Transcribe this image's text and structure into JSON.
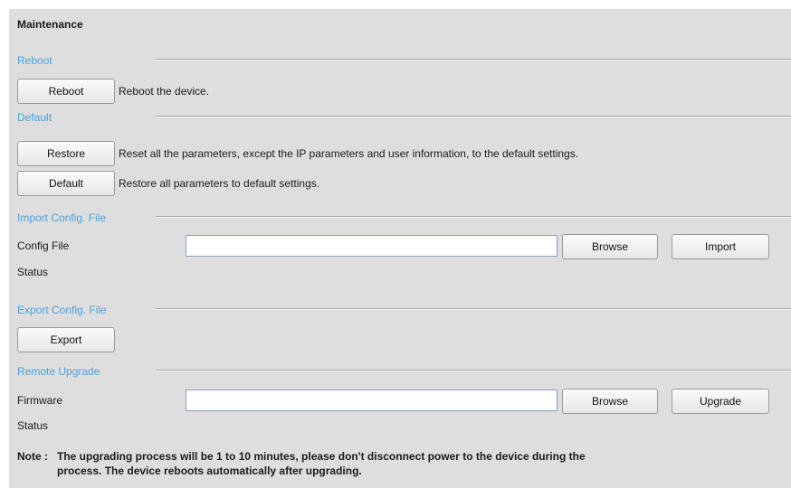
{
  "page": {
    "title": "Maintenance"
  },
  "reboot": {
    "section_label": "Reboot",
    "button_label": "Reboot",
    "description": "Reboot the device."
  },
  "default": {
    "section_label": "Default",
    "restore_button_label": "Restore",
    "restore_description": "Reset all the parameters, except the IP parameters and user information, to the default settings.",
    "default_button_label": "Default",
    "default_description": "Restore all parameters to default settings."
  },
  "import_config": {
    "section_label": "Import Config. File",
    "config_file_label": "Config File",
    "config_file_value": "",
    "browse_label": "Browse",
    "import_label": "Import",
    "status_label": "Status"
  },
  "export_config": {
    "section_label": "Export Config. File",
    "export_label": "Export"
  },
  "remote_upgrade": {
    "section_label": "Remote Upgrade",
    "firmware_label": "Firmware",
    "firmware_value": "",
    "browse_label": "Browse",
    "upgrade_label": "Upgrade",
    "status_label": "Status"
  },
  "note": {
    "prefix": "Note :",
    "line1_before": "The upgrading process will be ",
    "line1_highlight": "1 to 10",
    "line1_after": " minutes, please don't disconnect power to the device during the",
    "line2": "process. The device reboots automatically after upgrading."
  },
  "colors": {
    "panel_background": "#dedede",
    "section_label": "#4aa3df",
    "input_border": "#8a9fc0"
  }
}
